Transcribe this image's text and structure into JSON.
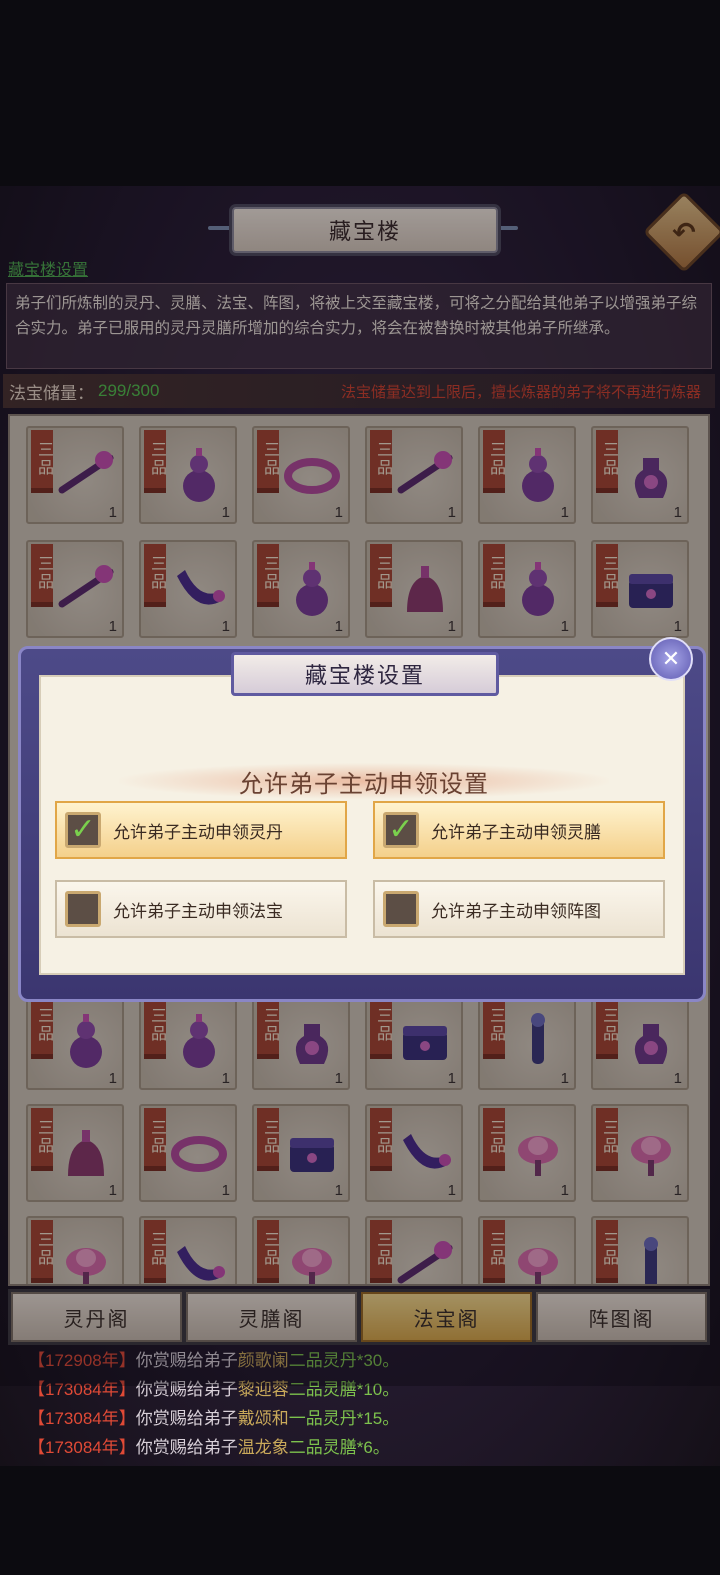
{
  "header": {
    "title": "藏宝楼"
  },
  "settings_link": "藏宝楼设置",
  "description": "弟子们所炼制的灵丹、灵膳、法宝、阵图，将被上交至藏宝楼，可将之分配给其他弟子以增强弟子综合实力。弟子已服用的灵丹灵膳所增加的综合实力，将会在被替换时被其他弟子所继承。",
  "storage": {
    "label": "法宝储量：",
    "value": "299/300",
    "warning": "法宝储量达到上限后，擅长炼器的弟子将不再进行炼器"
  },
  "grade_label": "三品",
  "items": [
    {
      "type": "rod",
      "qty": "1"
    },
    {
      "type": "gourd",
      "qty": "1"
    },
    {
      "type": "ring",
      "qty": "1"
    },
    {
      "type": "rod",
      "qty": "1"
    },
    {
      "type": "gourd",
      "qty": "1"
    },
    {
      "type": "vase",
      "qty": "1"
    },
    {
      "type": "rod",
      "qty": "1"
    },
    {
      "type": "horn",
      "qty": "1"
    },
    {
      "type": "gourd",
      "qty": "1"
    },
    {
      "type": "bell",
      "qty": "1"
    },
    {
      "type": "gourd",
      "qty": "1"
    },
    {
      "type": "chest",
      "qty": "1"
    },
    {
      "type": "gourd",
      "qty": "1"
    },
    {
      "type": "gourd",
      "qty": "1"
    },
    {
      "type": "vase",
      "qty": "1"
    },
    {
      "type": "chest",
      "qty": "1"
    },
    {
      "type": "figure",
      "qty": "1"
    },
    {
      "type": "vase",
      "qty": "1"
    },
    {
      "type": "bell",
      "qty": "1"
    },
    {
      "type": "ring",
      "qty": "1"
    },
    {
      "type": "chest",
      "qty": "1"
    },
    {
      "type": "horn",
      "qty": "1"
    },
    {
      "type": "lotus",
      "qty": "1"
    },
    {
      "type": "lotus",
      "qty": "1"
    },
    {
      "type": "lotus",
      "qty": "1"
    },
    {
      "type": "horn",
      "qty": "1"
    },
    {
      "type": "lotus",
      "qty": "1"
    },
    {
      "type": "rod",
      "qty": "1"
    },
    {
      "type": "lotus",
      "qty": "1"
    },
    {
      "type": "figure",
      "qty": "1"
    }
  ],
  "tabs": [
    "灵丹阁",
    "灵膳阁",
    "法宝阁",
    "阵图阁"
  ],
  "active_tab": 2,
  "log": [
    {
      "year": "【172908年】",
      "pre": "你赏赐给弟子",
      "name": "颜歌阑",
      "item": "二品灵丹*30。"
    },
    {
      "year": "【173084年】",
      "pre": "你赏赐给弟子",
      "name": "黎迎蓉",
      "item": "二品灵膳*10。"
    },
    {
      "year": "【173084年】",
      "pre": "你赏赐给弟子",
      "name": "戴颂和",
      "item": "一品灵丹*15。"
    },
    {
      "year": "【173084年】",
      "pre": "你赏赐给弟子",
      "name": "温龙象",
      "item": "二品灵膳*6。"
    }
  ],
  "modal": {
    "title": "藏宝楼设置",
    "heading": "允许弟子主动申领设置",
    "options": [
      {
        "label": "允许弟子主动申领灵丹",
        "checked": true
      },
      {
        "label": "允许弟子主动申领灵膳",
        "checked": true
      },
      {
        "label": "允许弟子主动申领法宝",
        "checked": false
      },
      {
        "label": "允许弟子主动申领阵图",
        "checked": false
      }
    ]
  },
  "icons": {
    "back": "back-arrow-icon",
    "close": "close-icon",
    "check": "checkmark-icon"
  },
  "colors": {
    "accent_green": "#54c24e",
    "warning_red": "#d2432e",
    "tab_active": "#d9a94a",
    "grade_tag": "#a74532"
  }
}
